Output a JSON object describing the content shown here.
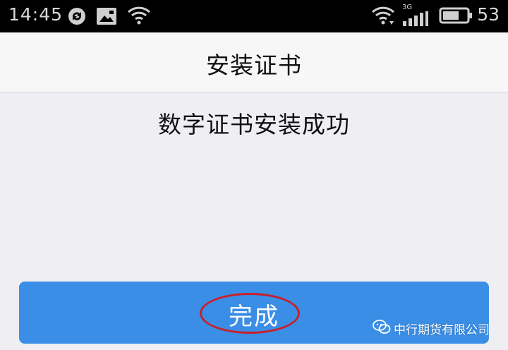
{
  "status_bar": {
    "time": "14:45",
    "network": "3G",
    "battery": "53",
    "icons": [
      "sync-icon",
      "image-icon",
      "wifi-icon",
      "wifi-download-icon",
      "signal-icon",
      "battery-icon"
    ]
  },
  "header": {
    "title": "安装证书"
  },
  "message": "数字证书安装成功",
  "done_button": {
    "label": "完成",
    "color": "#3a8ee6"
  },
  "watermark": {
    "text": "中行期货有限公司",
    "icon": "wechat-icon"
  },
  "colors": {
    "annotation": "#c8202a",
    "background": "#efeef3"
  }
}
